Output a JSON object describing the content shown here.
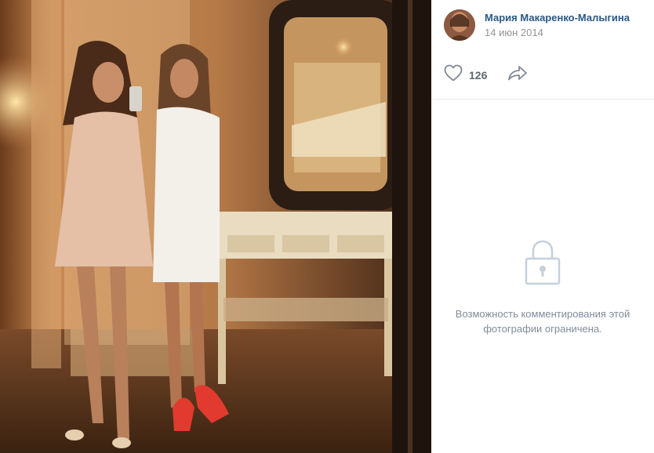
{
  "author": {
    "name": "Мария Макаренко-Малыгина",
    "date": "14 июн 2014",
    "avatar_icon": "user-avatar-photo"
  },
  "actions": {
    "like_icon": "heart-outline-icon",
    "like_count": "126",
    "share_icon": "share-arrow-icon"
  },
  "comments": {
    "lock_icon": "lock-icon",
    "restricted_message": "Возможность комментирования этой фотографии ограничена."
  },
  "colors": {
    "author_link": "#2a5885",
    "secondary_text": "#939393",
    "icon_gray": "#828a99",
    "muted_text": "#818c99",
    "divider": "#e7e8ec"
  }
}
